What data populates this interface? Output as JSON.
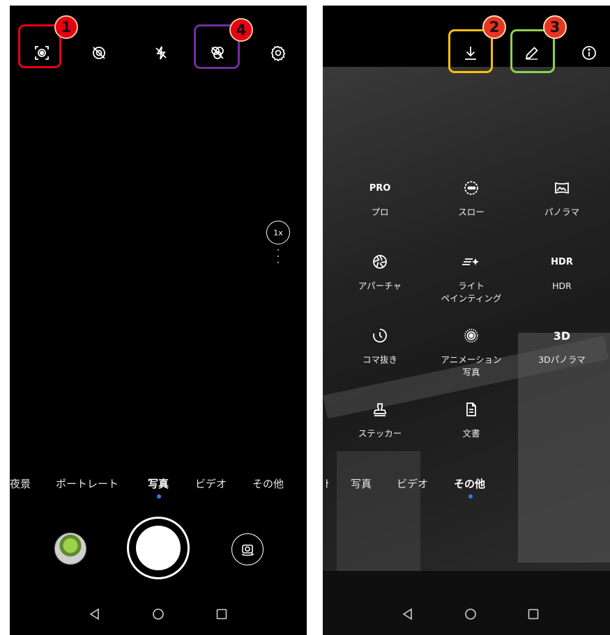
{
  "left_screen": {
    "zoom_label": "1x",
    "modes": [
      {
        "label": "夜景",
        "active": false
      },
      {
        "label": "ポートレート",
        "active": false
      },
      {
        "label": "写真",
        "active": true
      },
      {
        "label": "ビデオ",
        "active": false
      },
      {
        "label": "その他",
        "active": false
      }
    ],
    "icons": [
      "ai-scene-icon",
      "no-filter-icon",
      "flash-off-icon",
      "live-photo-off-icon",
      "settings-gear-icon"
    ]
  },
  "right_screen": {
    "top_icons": [
      "download-icon",
      "edit-pencil-icon",
      "info-icon"
    ],
    "grid": [
      {
        "icon_text": "PRO",
        "label": "プロ"
      },
      {
        "icon_text": "",
        "label": "スロー"
      },
      {
        "icon_text": "",
        "label": "パノラマ"
      },
      {
        "icon_text": "",
        "label": "アパーチャ"
      },
      {
        "icon_text": "",
        "label": "ライト\nペインティング"
      },
      {
        "icon_text": "HDR",
        "label": "HDR"
      },
      {
        "icon_text": "",
        "label": "コマ抜き"
      },
      {
        "icon_text": "",
        "label": "アニメーション\n写真"
      },
      {
        "icon_text": "3D",
        "label": "3Dパノラマ"
      },
      {
        "icon_text": "",
        "label": "ステッカー"
      },
      {
        "icon_text": "",
        "label": "文書"
      }
    ],
    "modes": [
      {
        "label": "写真",
        "active": false
      },
      {
        "label": "ビデオ",
        "active": false
      },
      {
        "label": "その他",
        "active": true
      }
    ]
  },
  "annotations": [
    {
      "number": "1",
      "color": "#e8000e"
    },
    {
      "number": "2",
      "color": "#ffc000"
    },
    {
      "number": "3",
      "color": "#8fd14f"
    },
    {
      "number": "4",
      "color": "#7030a0"
    }
  ]
}
